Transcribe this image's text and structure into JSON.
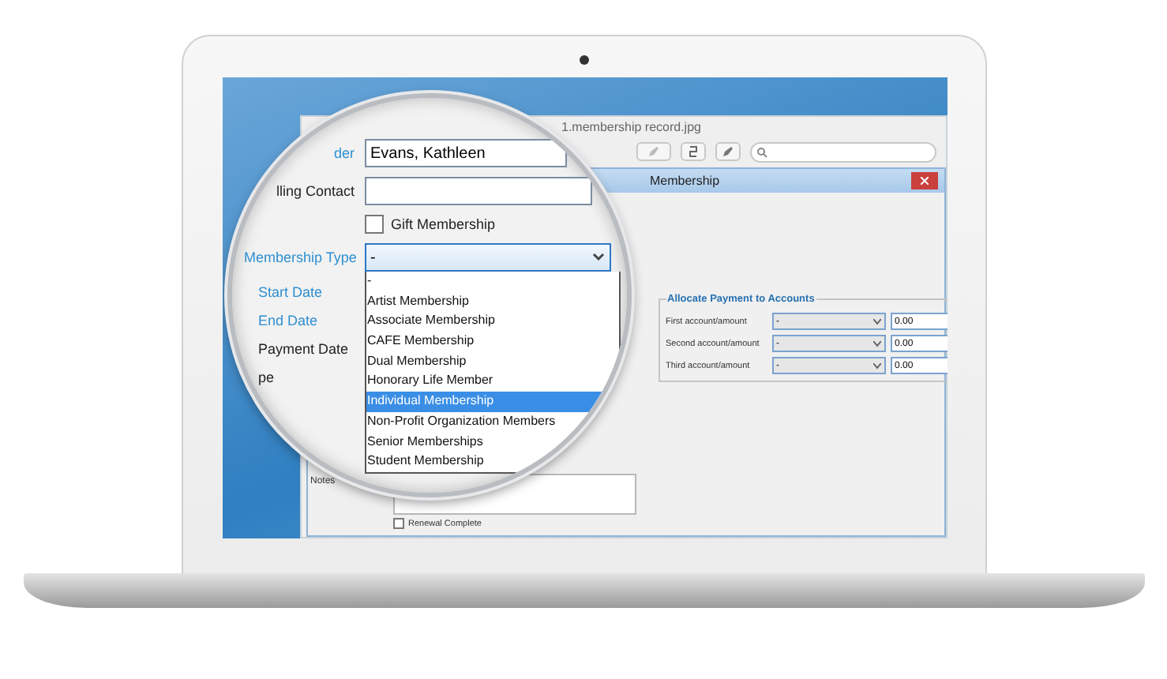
{
  "viewer": {
    "title": "1.membership record.jpg"
  },
  "dialog": {
    "title": "Membership"
  },
  "form_rows": [
    {
      "kind": "text",
      "label": "der",
      "value": "Evans, Kathleen"
    },
    {
      "kind": "text",
      "label": "lling Contact"
    },
    {
      "kind": "checkbox",
      "label": "Gift Membership",
      "checked": false
    },
    {
      "kind": "select",
      "label": "Membership Type",
      "value": "-",
      "expanded": true
    }
  ],
  "date_labels": [
    {
      "label": "Start Date",
      "required": true
    },
    {
      "label": "End Date",
      "required": true
    },
    {
      "label": "Payment Date",
      "required": false
    },
    {
      "label": "pe",
      "required": false
    }
  ],
  "options": [
    {
      "label": "-",
      "selected": false
    },
    {
      "label": "Artist Membership",
      "selected": false
    },
    {
      "label": "Associate Membership",
      "selected": false
    },
    {
      "label": "CAFE Membership",
      "selected": false
    },
    {
      "label": "Dual Membership",
      "selected": false
    },
    {
      "label": "Honorary Life Member",
      "selected": false
    },
    {
      "label": "Individual Membership",
      "selected": true
    },
    {
      "label": "Non-Profit Organization Members",
      "selected": false
    },
    {
      "label": "Senior Memberships",
      "selected": false
    },
    {
      "label": "Student Membership",
      "selected": false
    }
  ],
  "allocate": {
    "title": "Allocate Payment to Accounts",
    "rows": [
      {
        "label": "First account/amount",
        "account": "-",
        "amount": "0.00"
      },
      {
        "label": "Second account/amount",
        "account": "-",
        "amount": "0.00"
      },
      {
        "label": "Third account/amount",
        "account": "-",
        "amount": "0.00"
      }
    ]
  },
  "notes": {
    "label": "Notes"
  },
  "renewal": {
    "label": "Renewal Complete",
    "checked": false
  }
}
